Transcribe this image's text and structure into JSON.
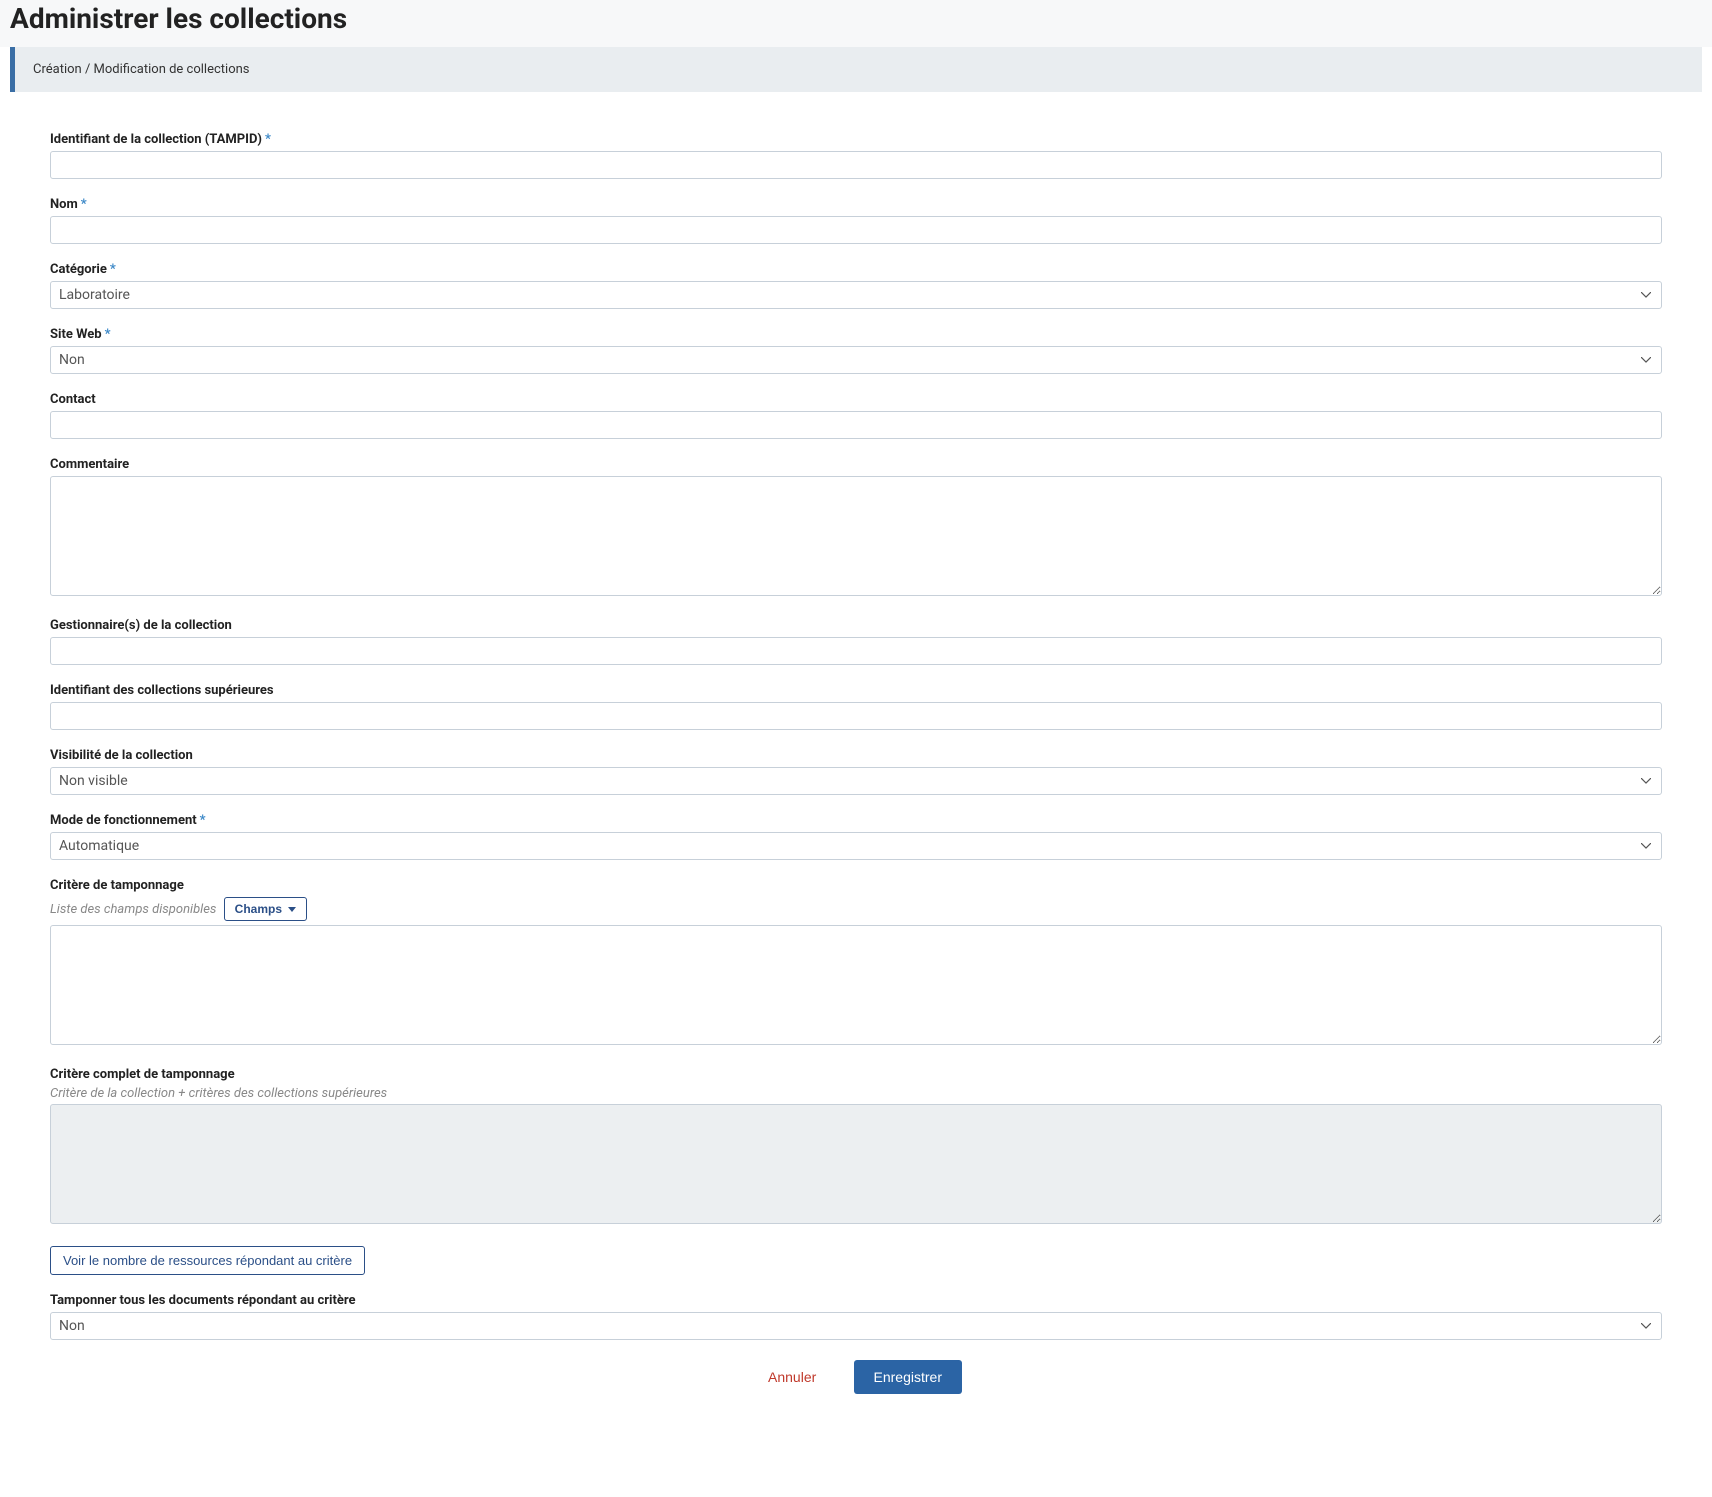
{
  "header": {
    "title": "Administrer les collections",
    "subtitle": "Création / Modification de collections"
  },
  "form": {
    "tampid": {
      "label": "Identifiant de la collection (TAMPID)",
      "value": ""
    },
    "nom": {
      "label": "Nom",
      "value": ""
    },
    "categorie": {
      "label": "Catégorie",
      "value": "Laboratoire"
    },
    "siteweb": {
      "label": "Site Web",
      "value": "Non"
    },
    "contact": {
      "label": "Contact",
      "value": ""
    },
    "commentaire": {
      "label": "Commentaire",
      "value": ""
    },
    "gestionnaires": {
      "label": "Gestionnaire(s) de la collection",
      "value": ""
    },
    "ident_sup": {
      "label": "Identifiant des collections supérieures",
      "value": ""
    },
    "visibilite": {
      "label": "Visibilité de la collection",
      "value": "Non visible"
    },
    "mode": {
      "label": "Mode de fonctionnement",
      "value": "Automatique"
    },
    "critere": {
      "label": "Critère de tamponnage",
      "helper": "Liste des champs disponibles",
      "champs_btn": "Champs",
      "value": ""
    },
    "critere_complet": {
      "label": "Critère complet de tamponnage",
      "helper": "Critère de la collection + critères des collections supérieures",
      "value": ""
    },
    "voir_nombre_btn": "Voir le nombre de ressources répondant au critère",
    "tamponner": {
      "label": "Tamponner tous les documents répondant au critère",
      "value": "Non"
    }
  },
  "buttons": {
    "cancel": "Annuler",
    "save": "Enregistrer"
  },
  "required_star": "*"
}
